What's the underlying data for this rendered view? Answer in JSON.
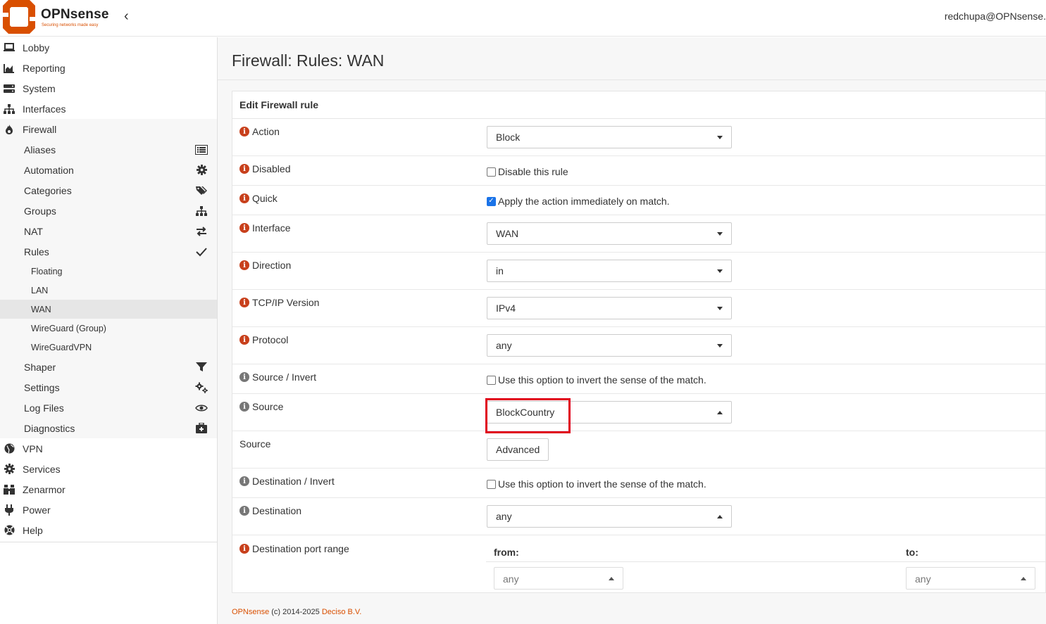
{
  "header": {
    "logo_name": "OPNsense",
    "logo_tagline": "Securing networks made easy",
    "user": "redchupa@OPNsense."
  },
  "sidebar": {
    "items": [
      {
        "label": "Lobby",
        "icon": "laptop-icon"
      },
      {
        "label": "Reporting",
        "icon": "area-chart-icon"
      },
      {
        "label": "System",
        "icon": "server-icon"
      },
      {
        "label": "Interfaces",
        "icon": "sitemap-icon"
      },
      {
        "label": "Firewall",
        "icon": "fire-icon"
      }
    ],
    "firewall_sub": [
      {
        "label": "Aliases",
        "icon": "list-icon"
      },
      {
        "label": "Automation",
        "icon": "gear-icon"
      },
      {
        "label": "Categories",
        "icon": "tags-icon"
      },
      {
        "label": "Groups",
        "icon": "sitemap-icon"
      },
      {
        "label": "NAT",
        "icon": "exchange-icon"
      },
      {
        "label": "Rules",
        "icon": "check-icon"
      }
    ],
    "rules_sub": [
      {
        "label": "Floating"
      },
      {
        "label": "LAN"
      },
      {
        "label": "WAN"
      },
      {
        "label": "WireGuard (Group)"
      },
      {
        "label": "WireGuardVPN"
      }
    ],
    "firewall_sub2": [
      {
        "label": "Shaper",
        "icon": "filter-icon"
      },
      {
        "label": "Settings",
        "icon": "gears-icon"
      },
      {
        "label": "Log Files",
        "icon": "eye-icon"
      },
      {
        "label": "Diagnostics",
        "icon": "medkit-icon"
      }
    ],
    "bottom_items": [
      {
        "label": "VPN",
        "icon": "globe-icon"
      },
      {
        "label": "Services",
        "icon": "cog-icon"
      },
      {
        "label": "Zenarmor",
        "icon": "binoculars-icon"
      },
      {
        "label": "Power",
        "icon": "plug-icon"
      },
      {
        "label": "Help",
        "icon": "life-ring-icon"
      }
    ]
  },
  "main": {
    "title": "Firewall: Rules: WAN",
    "panel_title": "Edit Firewall rule",
    "action": {
      "label": "Action",
      "value": "Block"
    },
    "disabled": {
      "label": "Disabled",
      "checkbox_label": "Disable this rule",
      "checked": false
    },
    "quick": {
      "label": "Quick",
      "checkbox_label": "Apply the action immediately on match.",
      "checked": true
    },
    "interface": {
      "label": "Interface",
      "value": "WAN"
    },
    "direction": {
      "label": "Direction",
      "value": "in"
    },
    "ipversion": {
      "label": "TCP/IP Version",
      "value": "IPv4"
    },
    "protocol": {
      "label": "Protocol",
      "value": "any"
    },
    "source_invert": {
      "label": "Source / Invert",
      "checkbox_label": "Use this option to invert the sense of the match.",
      "checked": false
    },
    "source": {
      "label": "Source",
      "value": "BlockCountry"
    },
    "source_adv": {
      "label": "Source",
      "button": "Advanced"
    },
    "dest_invert": {
      "label": "Destination / Invert",
      "checkbox_label": "Use this option to invert the sense of the match.",
      "checked": false
    },
    "destination": {
      "label": "Destination",
      "value": "any"
    },
    "dest_port": {
      "label": "Destination port range",
      "from_label": "from:",
      "to_label": "to:",
      "from_value": "any",
      "to_value": "any"
    }
  },
  "footer": {
    "org": "OPNsense",
    "copyright": " (c) 2014-2025 ",
    "company": "Deciso B.V."
  },
  "colors": {
    "accent": "#d94f00",
    "highlight": "#e0001b",
    "info": "#c8401c"
  }
}
